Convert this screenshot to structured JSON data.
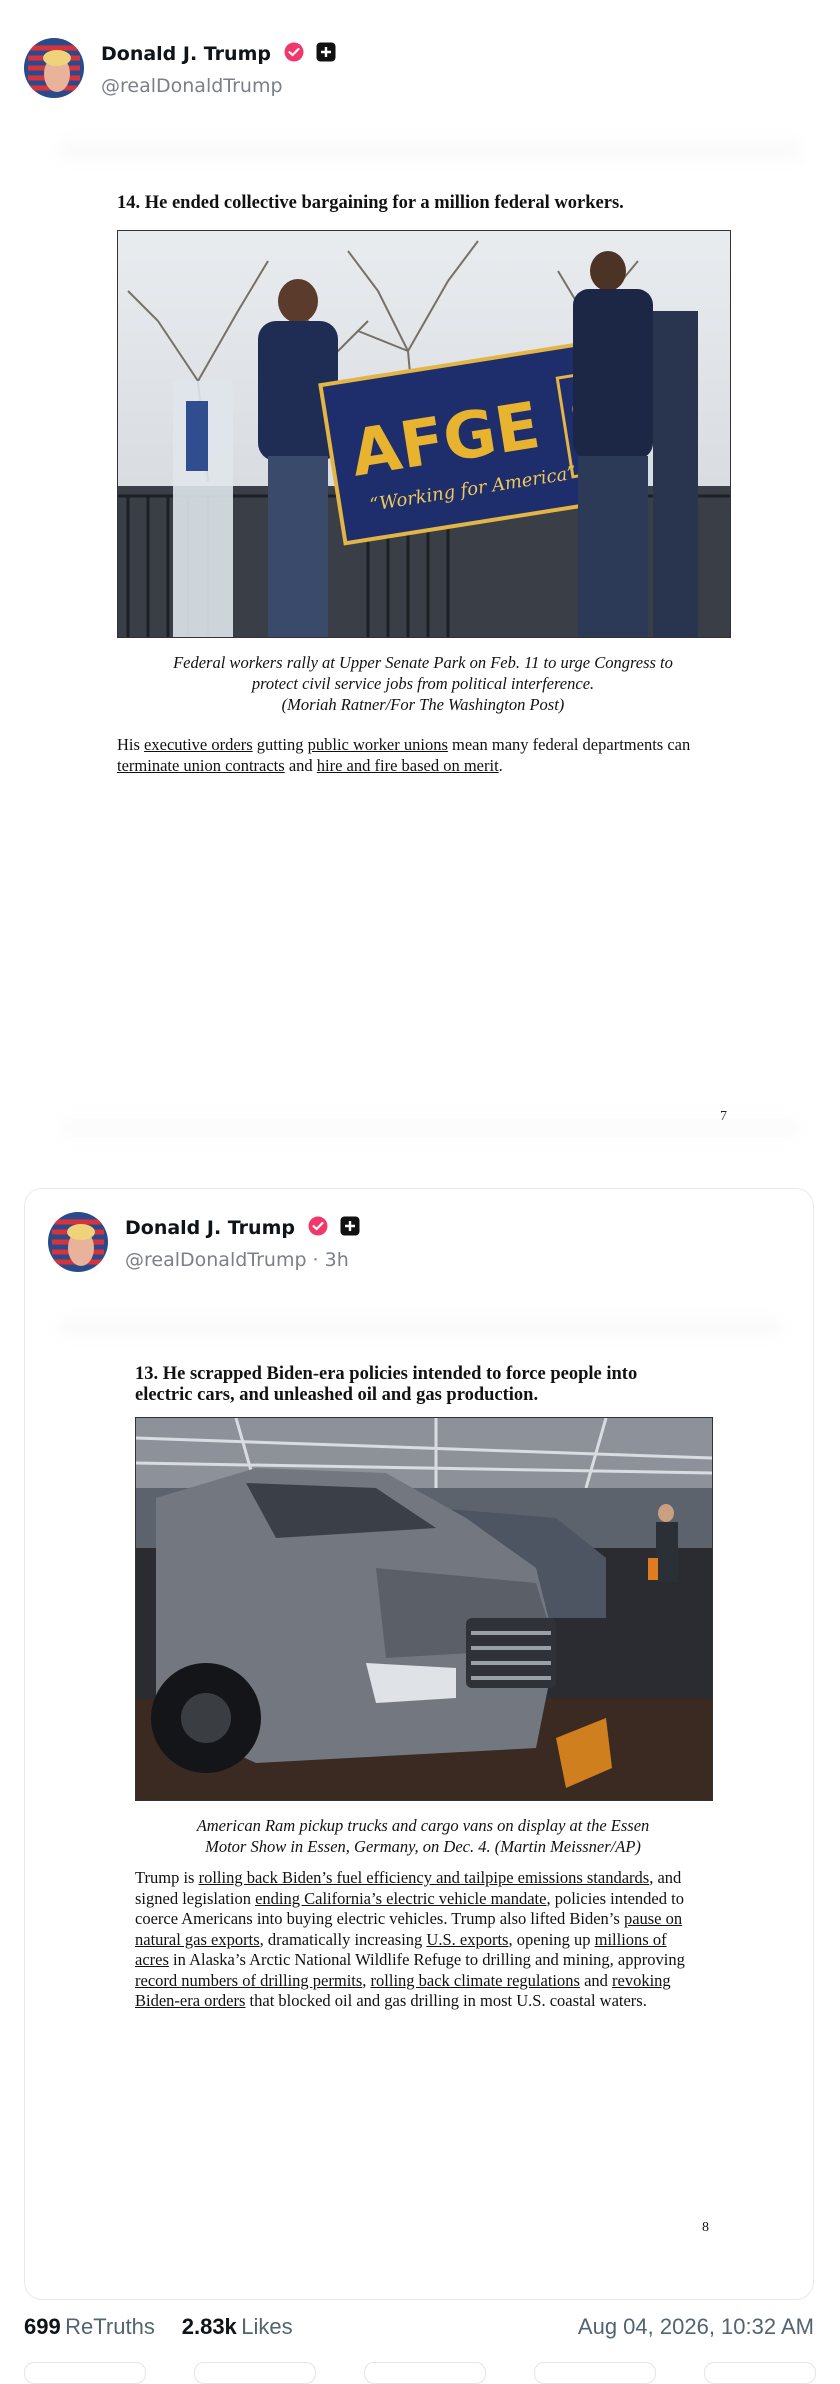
{
  "author": {
    "name": "Donald J. Trump",
    "handle": "@realDonaldTrump",
    "verified_color": "#f0386b",
    "badge_icon": "plus-square-icon"
  },
  "page1": {
    "heading": "14. He ended collective bargaining for a million federal workers.",
    "photo_alt_banner_main": "AFGE",
    "photo_alt_banner_sub": "“Working for America”",
    "caption_line1": "Federal workers rally at Upper Senate Park on Feb. 11 to urge Congress to",
    "caption_line2": "protect civil service jobs from political interference.",
    "caption_line3": "(Moriah Ratner/For The Washington Post)",
    "body": {
      "t1": "His ",
      "l1": "executive orders",
      "t2": " gutting ",
      "l2": "public worker unions",
      "t3": " mean many federal departments can ",
      "l3": "terminate union contracts",
      "t4": " and ",
      "l4": "hire and fire based on merit",
      "t5": "."
    },
    "page_number": "7"
  },
  "quoted_post": {
    "author_name": "Donald J. Trump",
    "handle_time": "@realDonaldTrump · 3h",
    "heading_line1": "13. He scrapped Biden-era policies intended to force people into",
    "heading_line2": "electric cars, and unleashed oil and gas production.",
    "caption_line1": "American Ram pickup trucks and cargo vans on display at the Essen",
    "caption_line2": "Motor Show in Essen, Germany, on Dec. 4. (Martin Meissner/AP)",
    "body": {
      "t1": "Trump is ",
      "l1": "rolling back Biden’s fuel efficiency and tailpipe emissions standards",
      "t2": ", and signed legislation ",
      "l2": "ending California’s electric vehicle mandate",
      "t3": ", policies intended to coerce Americans into buying electric vehicles. Trump also lifted Biden’s ",
      "l3": "pause on natural gas exports",
      "t4": ", dramatically increasing ",
      "l4": "U.S. exports",
      "t5": ", opening up ",
      "l5": "millions of acres",
      "t6": " in Alaska’s Arctic National Wildlife Refuge to drilling and mining, approving ",
      "l6": "record numbers of drilling permits",
      "t7": ", ",
      "l7": "rolling back climate regulations",
      "t8": " and ",
      "l8": "revoking Biden-era orders",
      "t9": " that blocked oil and gas drilling in most U.S. coastal waters."
    },
    "page_number": "8"
  },
  "stats": {
    "retruths_count": "699",
    "retruths_label": "ReTruths",
    "likes_count": "2.83k",
    "likes_label": "Likes",
    "timestamp": "Aug 04, 2026, 10:32 AM"
  }
}
